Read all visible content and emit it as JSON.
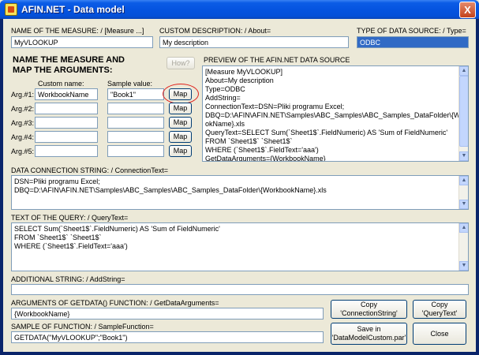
{
  "window": {
    "title": "AFIN.NET - Data model",
    "close_glyph": "X"
  },
  "measure": {
    "label": "NAME OF THE MEASURE: / [Measure ...]",
    "value": "MyVLOOKUP"
  },
  "description": {
    "label": "CUSTOM DESCRIPTION: / About=",
    "value": "My description"
  },
  "datasource_type": {
    "label": "TYPE OF DATA SOURCE: / Type=",
    "value": "ODBC"
  },
  "arguments": {
    "heading_line1": "NAME THE MEASURE AND",
    "heading_line2": "MAP THE ARGUMENTS:",
    "how_label": "How?",
    "custom_name_header": "Custom name:",
    "sample_value_header": "Sample value:",
    "rows": [
      {
        "label": "Arg.#1:",
        "name": "WorkbookName",
        "sample": "\"Book1\"",
        "map_label": "Map"
      },
      {
        "label": "Arg.#2:",
        "name": "",
        "sample": "",
        "map_label": "Map"
      },
      {
        "label": "Arg.#3:",
        "name": "",
        "sample": "",
        "map_label": "Map"
      },
      {
        "label": "Arg.#4:",
        "name": "",
        "sample": "",
        "map_label": "Map"
      },
      {
        "label": "Arg.#5:",
        "name": "",
        "sample": "",
        "map_label": "Map"
      }
    ]
  },
  "preview": {
    "label": "PREVIEW OF THE AFIN.NET DATA SOURCE",
    "lines": [
      "[Measure MyVLOOKUP]",
      "About=My description",
      "Type=ODBC",
      "AddString=",
      "ConnectionText=DSN=Pliki programu Excel;",
      "DBQ=D:\\AFIN\\AFIN.NET\\Samples\\ABC_Samples\\ABC_Samples_DataFolder\\{Workbo",
      "okName}.xls",
      "QueryText=SELECT Sum(`Sheet1$`.FieldNumeric) AS 'Sum of FieldNumeric'",
      "FROM `Sheet1$` `Sheet1$`",
      "WHERE (`Sheet1$`.FieldText='aaa')",
      "GetDataArguments={WorkbookName}"
    ]
  },
  "connection": {
    "label": "DATA CONNECTION STRING: / ConnectionText=",
    "lines": [
      "DSN=Pliki programu Excel;",
      "DBQ=D:\\AFIN\\AFIN.NET\\Samples\\ABC_Samples\\ABC_Samples_DataFolder\\{WorkbookName}.xls"
    ]
  },
  "query": {
    "label": "TEXT OF THE QUERY: / QueryText=",
    "lines": [
      "SELECT Sum(`Sheet1$`.FieldNumeric) AS 'Sum of FieldNumeric'",
      "FROM `Sheet1$` `Sheet1$`",
      "WHERE (`Sheet1$`.FieldText='aaa')"
    ]
  },
  "additional": {
    "label": "ADDITIONAL STRING: / AddString=",
    "value": ""
  },
  "getdata_args": {
    "label": "ARGUMENTS OF GETDATA() FUNCTION: / GetDataArguments=",
    "value": "{WorkbookName}"
  },
  "sample_function": {
    "label": "SAMPLE OF FUNCTION: / SampleFunction=",
    "value": "GETDATA(\"MyVLOOKUP\";\"Book1\")"
  },
  "buttons": {
    "copy_connection": "Copy 'ConnectionString'",
    "copy_query": "Copy 'QueryText'",
    "save_line1": "Save in",
    "save_line2": "'DataModelCustom.par'",
    "close": "Close"
  },
  "icons": {
    "app_icon": "afin-app-icon",
    "close": "close-icon",
    "scroll_up": "scroll-up-arrow-icon",
    "scroll_down": "scroll-down-arrow-icon"
  },
  "colors": {
    "titlebar": "#0554e0",
    "selection": "#316ac5",
    "highlight_ring": "#e0201a",
    "dialog_bg": "#ece9d8"
  }
}
